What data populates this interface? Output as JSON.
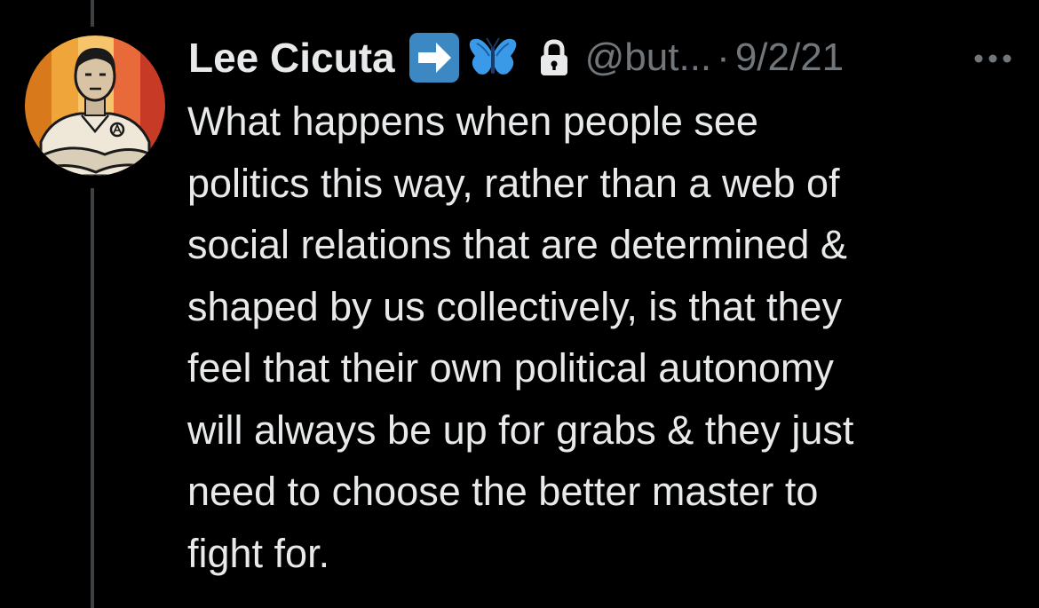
{
  "tweet": {
    "author": {
      "display_name": "Lee Cicuta",
      "handle": "@but...",
      "badges": [
        "right-arrow-emoji",
        "butterfly-emoji"
      ],
      "protected_icon": "lock-icon",
      "avatar": "avatar-illustration"
    },
    "separator": "·",
    "date": "9/2/21",
    "more_icon": "more-horizontal-icon",
    "text": "What happens when people see\npolitics this way, rather than a web of\nsocial relations that are determined &\nshaped by us collectively, is that they\nfeel that their own political autonomy\nwill always be up for grabs & they just\nneed to choose the better master to\nfight for."
  },
  "colors": {
    "background": "#000000",
    "text_primary": "#e7e9ea",
    "text_secondary": "#71767b",
    "thread_line": "#3e4144",
    "arrow_emoji_bg": "#3b88c3",
    "butterfly_blue": "#3b9ae8"
  }
}
